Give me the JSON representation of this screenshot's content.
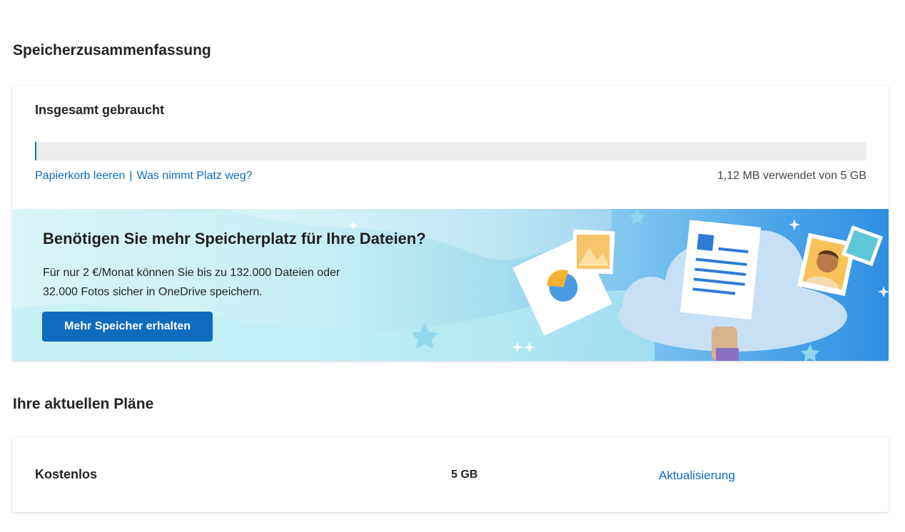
{
  "summary": {
    "section_title": "Speicherzusammenfassung",
    "used_heading": "Insgesamt gebraucht",
    "used_fraction": 0.0002,
    "empty_trash_link": "Papierkorb leeren",
    "separator": "|",
    "what_takes_space_link": "Was nimmt Platz weg?",
    "usage_text": "1,12 MB verwendet von 5 GB"
  },
  "promo": {
    "title": "Benötigen Sie mehr Speicherplatz für Ihre Dateien?",
    "text_line1": "Für nur 2 €/Monat können Sie bis zu 132.000 Dateien oder",
    "text_line2": "32.000 Fotos sicher in OneDrive speichern.",
    "button_label": "Mehr Speicher erhalten"
  },
  "plans": {
    "section_title": "Ihre aktuellen Pläne",
    "items": [
      {
        "name": "Kostenlos",
        "size": "5 GB",
        "action": "Aktualisierung"
      }
    ]
  },
  "colors": {
    "accent": "#0f6cbd",
    "progress_track": "#ededed"
  }
}
